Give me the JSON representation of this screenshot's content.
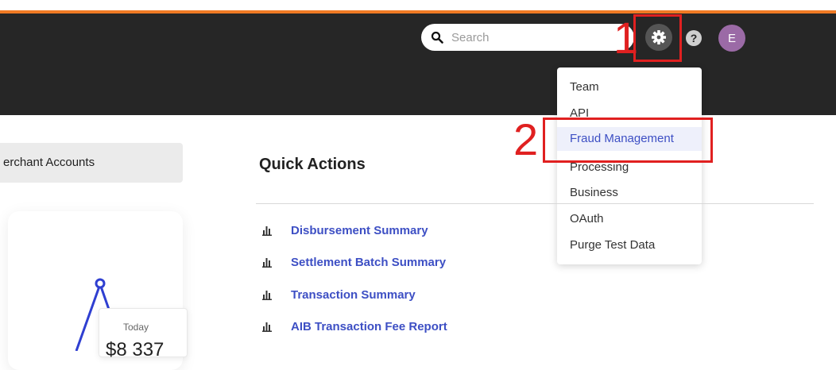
{
  "header": {
    "search": {
      "placeholder": "Search",
      "value": ""
    },
    "gear_icon": "gear-icon",
    "help_label": "?",
    "avatar_initial": "E",
    "accent_color": "#f07a24",
    "header_bg": "#262626"
  },
  "annotations": {
    "step_1": "1",
    "step_2": "2"
  },
  "settings_menu": {
    "items": [
      {
        "label": "Team"
      },
      {
        "label": "API"
      },
      {
        "label": "Fraud Management"
      },
      {
        "label": "Processing"
      },
      {
        "label": "Business"
      },
      {
        "label": "OAuth"
      },
      {
        "label": "Purge Test Data"
      }
    ]
  },
  "sidebar": {
    "merchant_tab_label": "erchant Accounts"
  },
  "quick_actions": {
    "title": "Quick Actions",
    "items": [
      {
        "label": "Disbursement Summary"
      },
      {
        "label": "Settlement Batch Summary"
      },
      {
        "label": "Transaction Summary"
      },
      {
        "label": "AIB Transaction Fee Report"
      }
    ]
  },
  "chart_card": {
    "tooltip_label": "Today",
    "tooltip_value": "$8 337",
    "line_color": "#2f3fd1"
  }
}
